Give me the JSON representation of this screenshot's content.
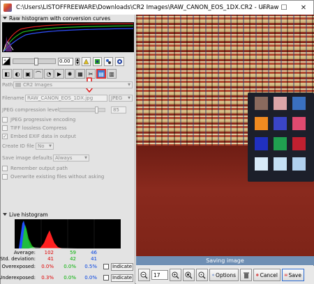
{
  "window": {
    "title": "C:\\Users\\LISTOFFREEWARE\\Downloads\\CR2 Images\\RAW_CANON_EOS_1DX.CR2 - UFRaw",
    "minimize": "—",
    "maximize": "☐",
    "close": "✕"
  },
  "raw_histogram": {
    "title": "Raw histogram with conversion curves"
  },
  "exposure": {
    "value": "0.00"
  },
  "save": {
    "path_label": "Path",
    "path_value": "CR2 Images",
    "filename_label": "Filename",
    "filename_value": "RAW_CANON_EOS_1DX.jpg",
    "format_value": "JPEG",
    "jpeg_level_label": "JPEG compression level",
    "jpeg_level_value": "85",
    "progressive_label": "JPEG progressive encoding",
    "tiff_label": "TIFF lossless Compress",
    "exif_label": "Embed EXIF data in output",
    "exif_checked": "✓",
    "create_id_label": "Create ID file",
    "create_id_value": "No",
    "defaults_label": "Save image defaults",
    "defaults_value": "Always",
    "remember_label": "Remember output path",
    "overwrite_label": "Overwrite existing files without asking"
  },
  "live_histogram": {
    "title": "Live histogram",
    "average_label": "Average:",
    "average": [
      "102",
      "59",
      "46"
    ],
    "std_label": "Std. deviation:",
    "std": [
      "41",
      "42",
      "41"
    ],
    "over_label": "Overexposed:",
    "over": [
      "0.0%",
      "0.0%",
      "0.5%"
    ],
    "under_label": "Underexposed:",
    "under": [
      "0.3%",
      "0.0%",
      "0.0%"
    ],
    "indicate_label": "Indicate"
  },
  "preview": {
    "status": "Saving image"
  },
  "bottom_bar": {
    "zoom_value": "17",
    "options_label": "Options",
    "cancel_label": "Cancel",
    "save_label": "Save"
  },
  "colors": {
    "accent_tab": "#3a7dd8",
    "highlight_red": "#e03030",
    "status_bar": "#6f8fb4"
  }
}
